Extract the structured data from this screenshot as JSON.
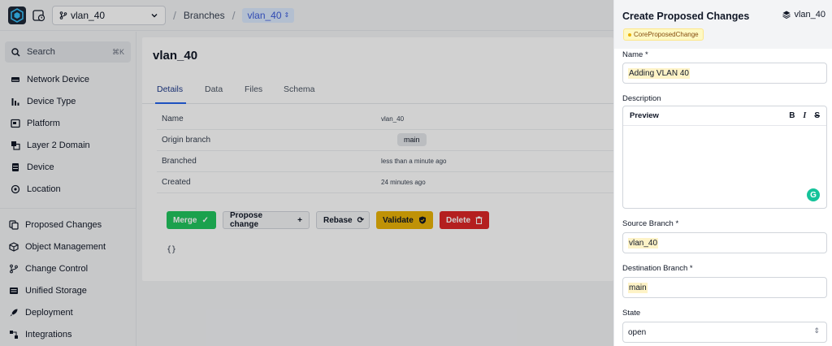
{
  "topbar": {
    "branch": "vlan_40",
    "crumb_branches": "Branches",
    "crumb_current": "vlan_40"
  },
  "sidebar": {
    "search_label": "Search",
    "search_shortcut": "⌘K",
    "primary": [
      {
        "label": "Network Device",
        "icon": "server-icon"
      },
      {
        "label": "Device Type",
        "icon": "bar-chart-icon"
      },
      {
        "label": "Platform",
        "icon": "platform-icon"
      },
      {
        "label": "Layer 2 Domain",
        "icon": "layers-icon"
      },
      {
        "label": "Device",
        "icon": "database-icon"
      },
      {
        "label": "Location",
        "icon": "location-icon"
      }
    ],
    "secondary": [
      {
        "label": "Proposed Changes",
        "icon": "proposed-changes-icon"
      },
      {
        "label": "Object Management",
        "icon": "cube-icon"
      },
      {
        "label": "Change Control",
        "icon": "git-branch-icon"
      },
      {
        "label": "Unified Storage",
        "icon": "storage-icon"
      },
      {
        "label": "Deployment",
        "icon": "rocket-icon"
      },
      {
        "label": "Integrations",
        "icon": "integrations-icon"
      }
    ]
  },
  "main": {
    "title": "vlan_40",
    "tabs": [
      "Details",
      "Data",
      "Files",
      "Schema"
    ],
    "details": [
      {
        "key": "Name",
        "value": "vlan_40"
      },
      {
        "key": "Origin branch",
        "value": "main"
      },
      {
        "key": "Branched",
        "value": "less than a minute ago"
      },
      {
        "key": "Created",
        "value": "24 minutes ago"
      }
    ],
    "actions": {
      "merge": "Merge",
      "propose": "Propose change",
      "rebase": "Rebase",
      "validate": "Validate",
      "delete": "Delete"
    },
    "json_output": "{}"
  },
  "drawer": {
    "title": "Create Proposed Changes",
    "branch": "vlan_40",
    "kind": "CoreProposedChange",
    "name_label": "Name *",
    "name_value": "Adding VLAN 40",
    "description_label": "Description",
    "editor_tab": "Preview",
    "source_label": "Source Branch *",
    "source_value": "vlan_40",
    "destination_label": "Destination Branch *",
    "destination_value": "main",
    "state_label": "State",
    "state_value": "open"
  },
  "colors": {
    "accent": "#2563eb",
    "merge": "#22c55e",
    "validate": "#eab308",
    "delete": "#dc2626",
    "highlight": "#fef3c7"
  }
}
